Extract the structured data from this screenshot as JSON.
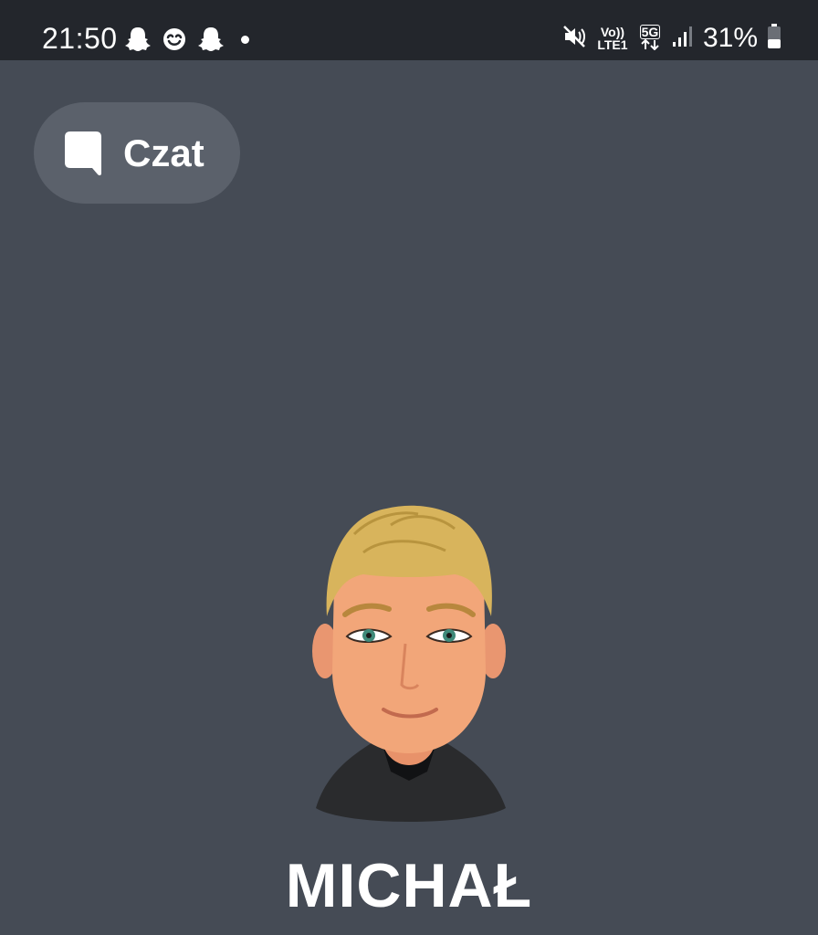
{
  "status_bar": {
    "time": "21:50",
    "notifications": [
      "snapchat-ghost-icon",
      "heart-smile-icon",
      "snapchat-ghost-icon"
    ],
    "network_volte_top": "Vo))",
    "network_volte_bottom": "LTE1",
    "network_5g": "5G",
    "battery": "31%"
  },
  "chat_button": {
    "label": "Czat"
  },
  "profile": {
    "name": "MICHAŁ"
  },
  "colors": {
    "background": "#454b55",
    "status_bar": "#23262c",
    "chat_button": "#5b616b",
    "text": "#ffffff"
  }
}
